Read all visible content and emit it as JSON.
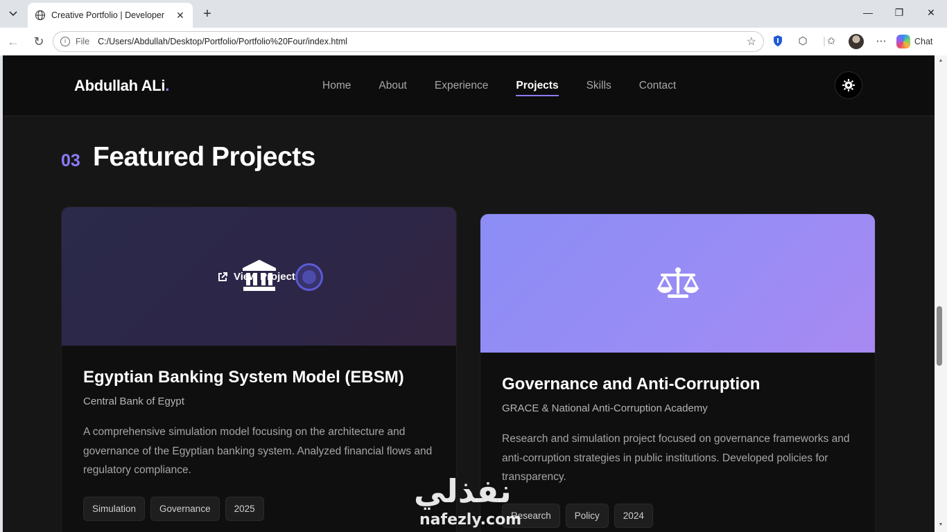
{
  "browser": {
    "tab_title": "Creative Portfolio | Developer",
    "address_prefix": "File",
    "url": "C:/Users/Abdullah/Desktop/Portfolio/Portfolio%20Four/index.html",
    "chat_label": "Chat"
  },
  "site": {
    "logo_text": "Abdullah ALi",
    "logo_dot": ".",
    "nav": [
      {
        "label": "Home"
      },
      {
        "label": "About"
      },
      {
        "label": "Experience"
      },
      {
        "label": "Projects"
      },
      {
        "label": "Skills"
      },
      {
        "label": "Contact"
      }
    ],
    "active_nav": "Projects"
  },
  "section": {
    "number": "03",
    "title": "Featured Projects"
  },
  "projects": [
    {
      "icon": "bank-icon",
      "overlay_label": "View Project",
      "title": "Egyptian Banking System Model (EBSM)",
      "org": "Central Bank of Egypt",
      "description": "A comprehensive simulation model focusing on the architecture and governance of the Egyptian banking system. Analyzed financial flows and regulatory compliance.",
      "tags": [
        "Simulation",
        "Governance",
        "2025"
      ]
    },
    {
      "icon": "scale-icon",
      "title": "Governance and Anti-Corruption",
      "org": "GRACE & National Anti-Corruption Academy",
      "description": "Research and simulation project focused on governance frameworks and anti-corruption strategies in public institutions. Developed policies for transparency.",
      "tags": [
        "Research",
        "Policy",
        "2024"
      ]
    }
  ],
  "watermark": {
    "arabic": "نفذلي",
    "latin": "nafezly.com"
  },
  "colors": {
    "accent": "#8b7cf6",
    "background": "#161616",
    "header": "#0d0d0d"
  }
}
